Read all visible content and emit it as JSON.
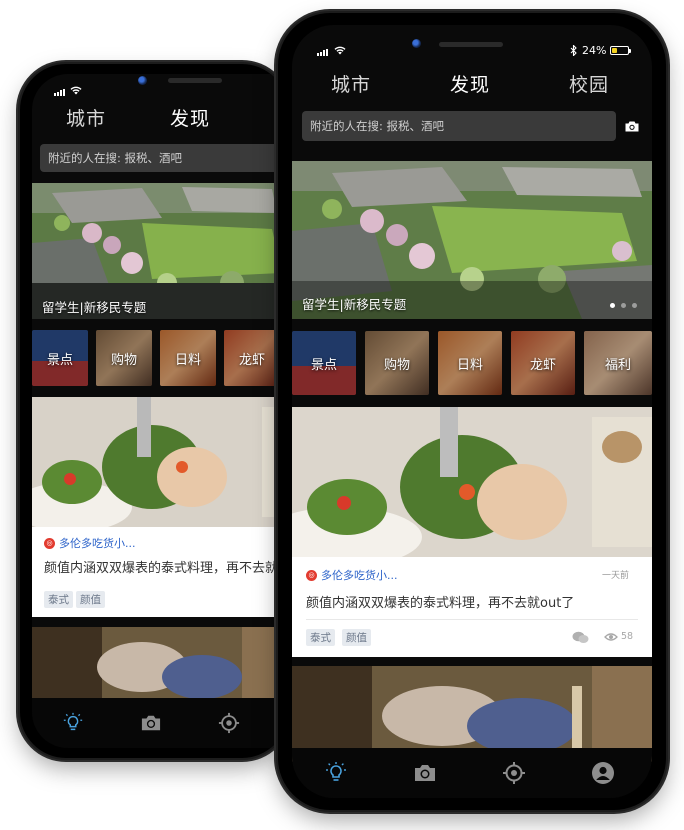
{
  "status": {
    "battery_text": "24%"
  },
  "top_tabs": [
    {
      "label": "城市"
    },
    {
      "label": "发现"
    },
    {
      "label": "校园"
    }
  ],
  "search": {
    "placeholder": "附近的人在搜: 报税、酒吧"
  },
  "banner": {
    "caption": "留学生|新移民专题",
    "dots": 3,
    "active_dot": 0
  },
  "categories": [
    {
      "label": "景点",
      "icon": "windmill-tulips-photo"
    },
    {
      "label": "购物",
      "icon": "shopping-people-photo"
    },
    {
      "label": "日料",
      "icon": "sushi-plate-photo"
    },
    {
      "label": "龙虾",
      "icon": "lobster-photo"
    },
    {
      "label": "福利",
      "icon": "gift-hands-photo"
    }
  ],
  "feed": [
    {
      "source": "多伦多吃货小...",
      "source_short": "多伦多吃货小...",
      "time": "一天前",
      "title": "颜值内涵双双爆表的泰式料理，再不去就out了",
      "title_short": "颜值内涵双双爆表的泰式料理，再不去就",
      "tags": [
        "泰式",
        "颜值"
      ],
      "views": "58"
    }
  ],
  "bottom_nav": [
    {
      "name": "discover",
      "icon": "lightbulb-icon",
      "active": true
    },
    {
      "name": "camera",
      "icon": "camera-icon",
      "active": false
    },
    {
      "name": "location",
      "icon": "location-target-icon",
      "active": false
    },
    {
      "name": "profile",
      "icon": "user-profile-icon",
      "active": false
    }
  ],
  "colors": {
    "active_nav": "#4aa3df",
    "source_link": "#2b62c9",
    "source_logo": "#e23b2f",
    "battery": "#f4d21f",
    "tag_bg": "#e6eaef"
  }
}
